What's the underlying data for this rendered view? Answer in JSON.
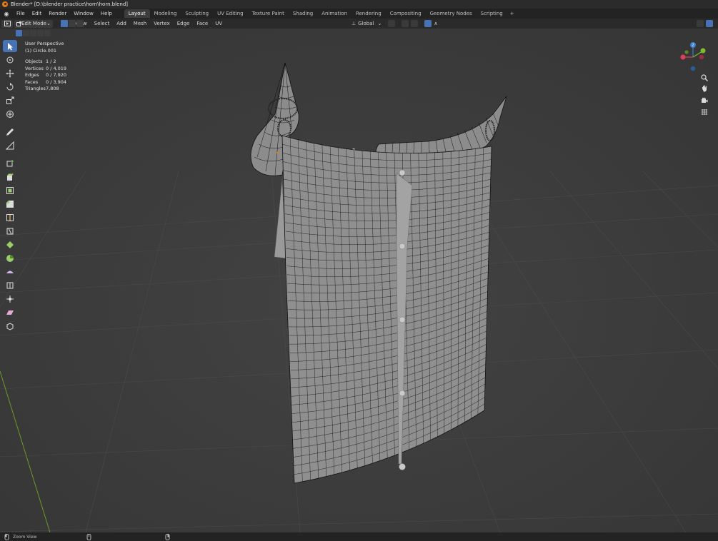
{
  "title_bar": {
    "text": "Blender* [D:\\blender practice\\horn\\horn.blend]"
  },
  "menu": {
    "items": [
      "File",
      "Edit",
      "Render",
      "Window",
      "Help"
    ]
  },
  "workspaces": {
    "tabs": [
      "Layout",
      "Modeling",
      "Sculpting",
      "UV Editing",
      "Texture Paint",
      "Shading",
      "Animation",
      "Rendering",
      "Compositing",
      "Geometry Nodes",
      "Scripting"
    ],
    "active": "Layout",
    "add_label": "+"
  },
  "header": {
    "mode": "Edit Mode",
    "menus": [
      "View",
      "Select",
      "Add",
      "Mesh",
      "Vertex",
      "Edge",
      "Face",
      "UV"
    ],
    "orientation": "Global"
  },
  "overlay": {
    "view_name": "User Perspective",
    "object_name": "(1) Circle.001",
    "stats": [
      {
        "label": "Objects",
        "value": "1 / 2"
      },
      {
        "label": "Vertices",
        "value": "0 / 4,019"
      },
      {
        "label": "Edges",
        "value": "0 / 7,920"
      },
      {
        "label": "Faces",
        "value": "0 / 3,904"
      },
      {
        "label": "Triangles",
        "value": "7,808"
      }
    ]
  },
  "gizmo": {
    "axis_z": "Z",
    "colors": {
      "x": "#e0405a",
      "y": "#7bbd2a",
      "z": "#3a7fd6"
    }
  },
  "toolbar": {
    "tools": [
      "select-box",
      "cursor",
      "move",
      "rotate",
      "scale",
      "transform",
      "annotate",
      "measure",
      "add-cube",
      "extrude-region",
      "inset-faces",
      "bevel",
      "loop-cut",
      "knife",
      "poly-build",
      "spin",
      "smooth",
      "edge-slide",
      "shrink-fatten",
      "shear",
      "rip-region"
    ]
  },
  "status": {
    "action": "Zoom View"
  },
  "colors": {
    "accent": "#4772b3",
    "viewport_bg": "#3c3c3c",
    "mesh_face": "#8f8f8f",
    "edge": "#1a1a1a",
    "blender_orange": "#e87d0d"
  }
}
